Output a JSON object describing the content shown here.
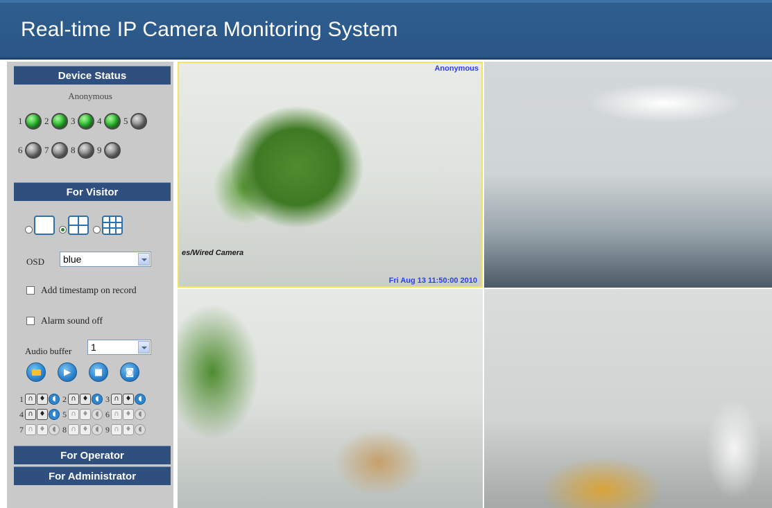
{
  "header": {
    "title": "Real-time IP Camera Monitoring System"
  },
  "sidebar": {
    "device_status": {
      "heading": "Device Status",
      "user": "Anonymous",
      "devices": [
        {
          "num": "1",
          "state": "online"
        },
        {
          "num": "2",
          "state": "online"
        },
        {
          "num": "3",
          "state": "online"
        },
        {
          "num": "4",
          "state": "online"
        },
        {
          "num": "5",
          "state": "offline"
        },
        {
          "num": "6",
          "state": "offline"
        },
        {
          "num": "7",
          "state": "offline"
        },
        {
          "num": "8",
          "state": "offline"
        },
        {
          "num": "9",
          "state": "offline"
        }
      ]
    },
    "visitor": {
      "heading": "For Visitor",
      "layout_options": [
        "1 view",
        "4 views",
        "9 views"
      ],
      "selected_layout": "4 views",
      "osd_label": "OSD",
      "osd_value": "blue",
      "timestamp_label": "Add timestamp on record",
      "alarm_label": "Alarm sound off",
      "audio_buffer_label": "Audio buffer",
      "audio_buffer_value": "1",
      "controls": [
        "folder-icon",
        "play-icon",
        "stop-icon",
        "snapshot-icon"
      ],
      "camera_controls": [
        {
          "num": "1",
          "active": true
        },
        {
          "num": "2",
          "active": true
        },
        {
          "num": "3",
          "active": true
        },
        {
          "num": "4",
          "active": true
        },
        {
          "num": "5",
          "active": false
        },
        {
          "num": "6",
          "active": false
        },
        {
          "num": "7",
          "active": false
        },
        {
          "num": "8",
          "active": false
        },
        {
          "num": "9",
          "active": false
        }
      ]
    },
    "operator": {
      "heading": "For Operator"
    },
    "administrator": {
      "heading": "For Administrator"
    }
  },
  "video": {
    "cell1": {
      "osd_user": "Anonymous",
      "osd_time": "Fri Aug 13 11:50:00 2010",
      "sign_text": "es/Wired Camera"
    },
    "accent_color": "#f2e35a",
    "osd_color": "#2d3cf2"
  },
  "colors": {
    "header": "#2f5f8f",
    "section": "#2f4f7f",
    "sidebar": "#c9c9c9"
  }
}
